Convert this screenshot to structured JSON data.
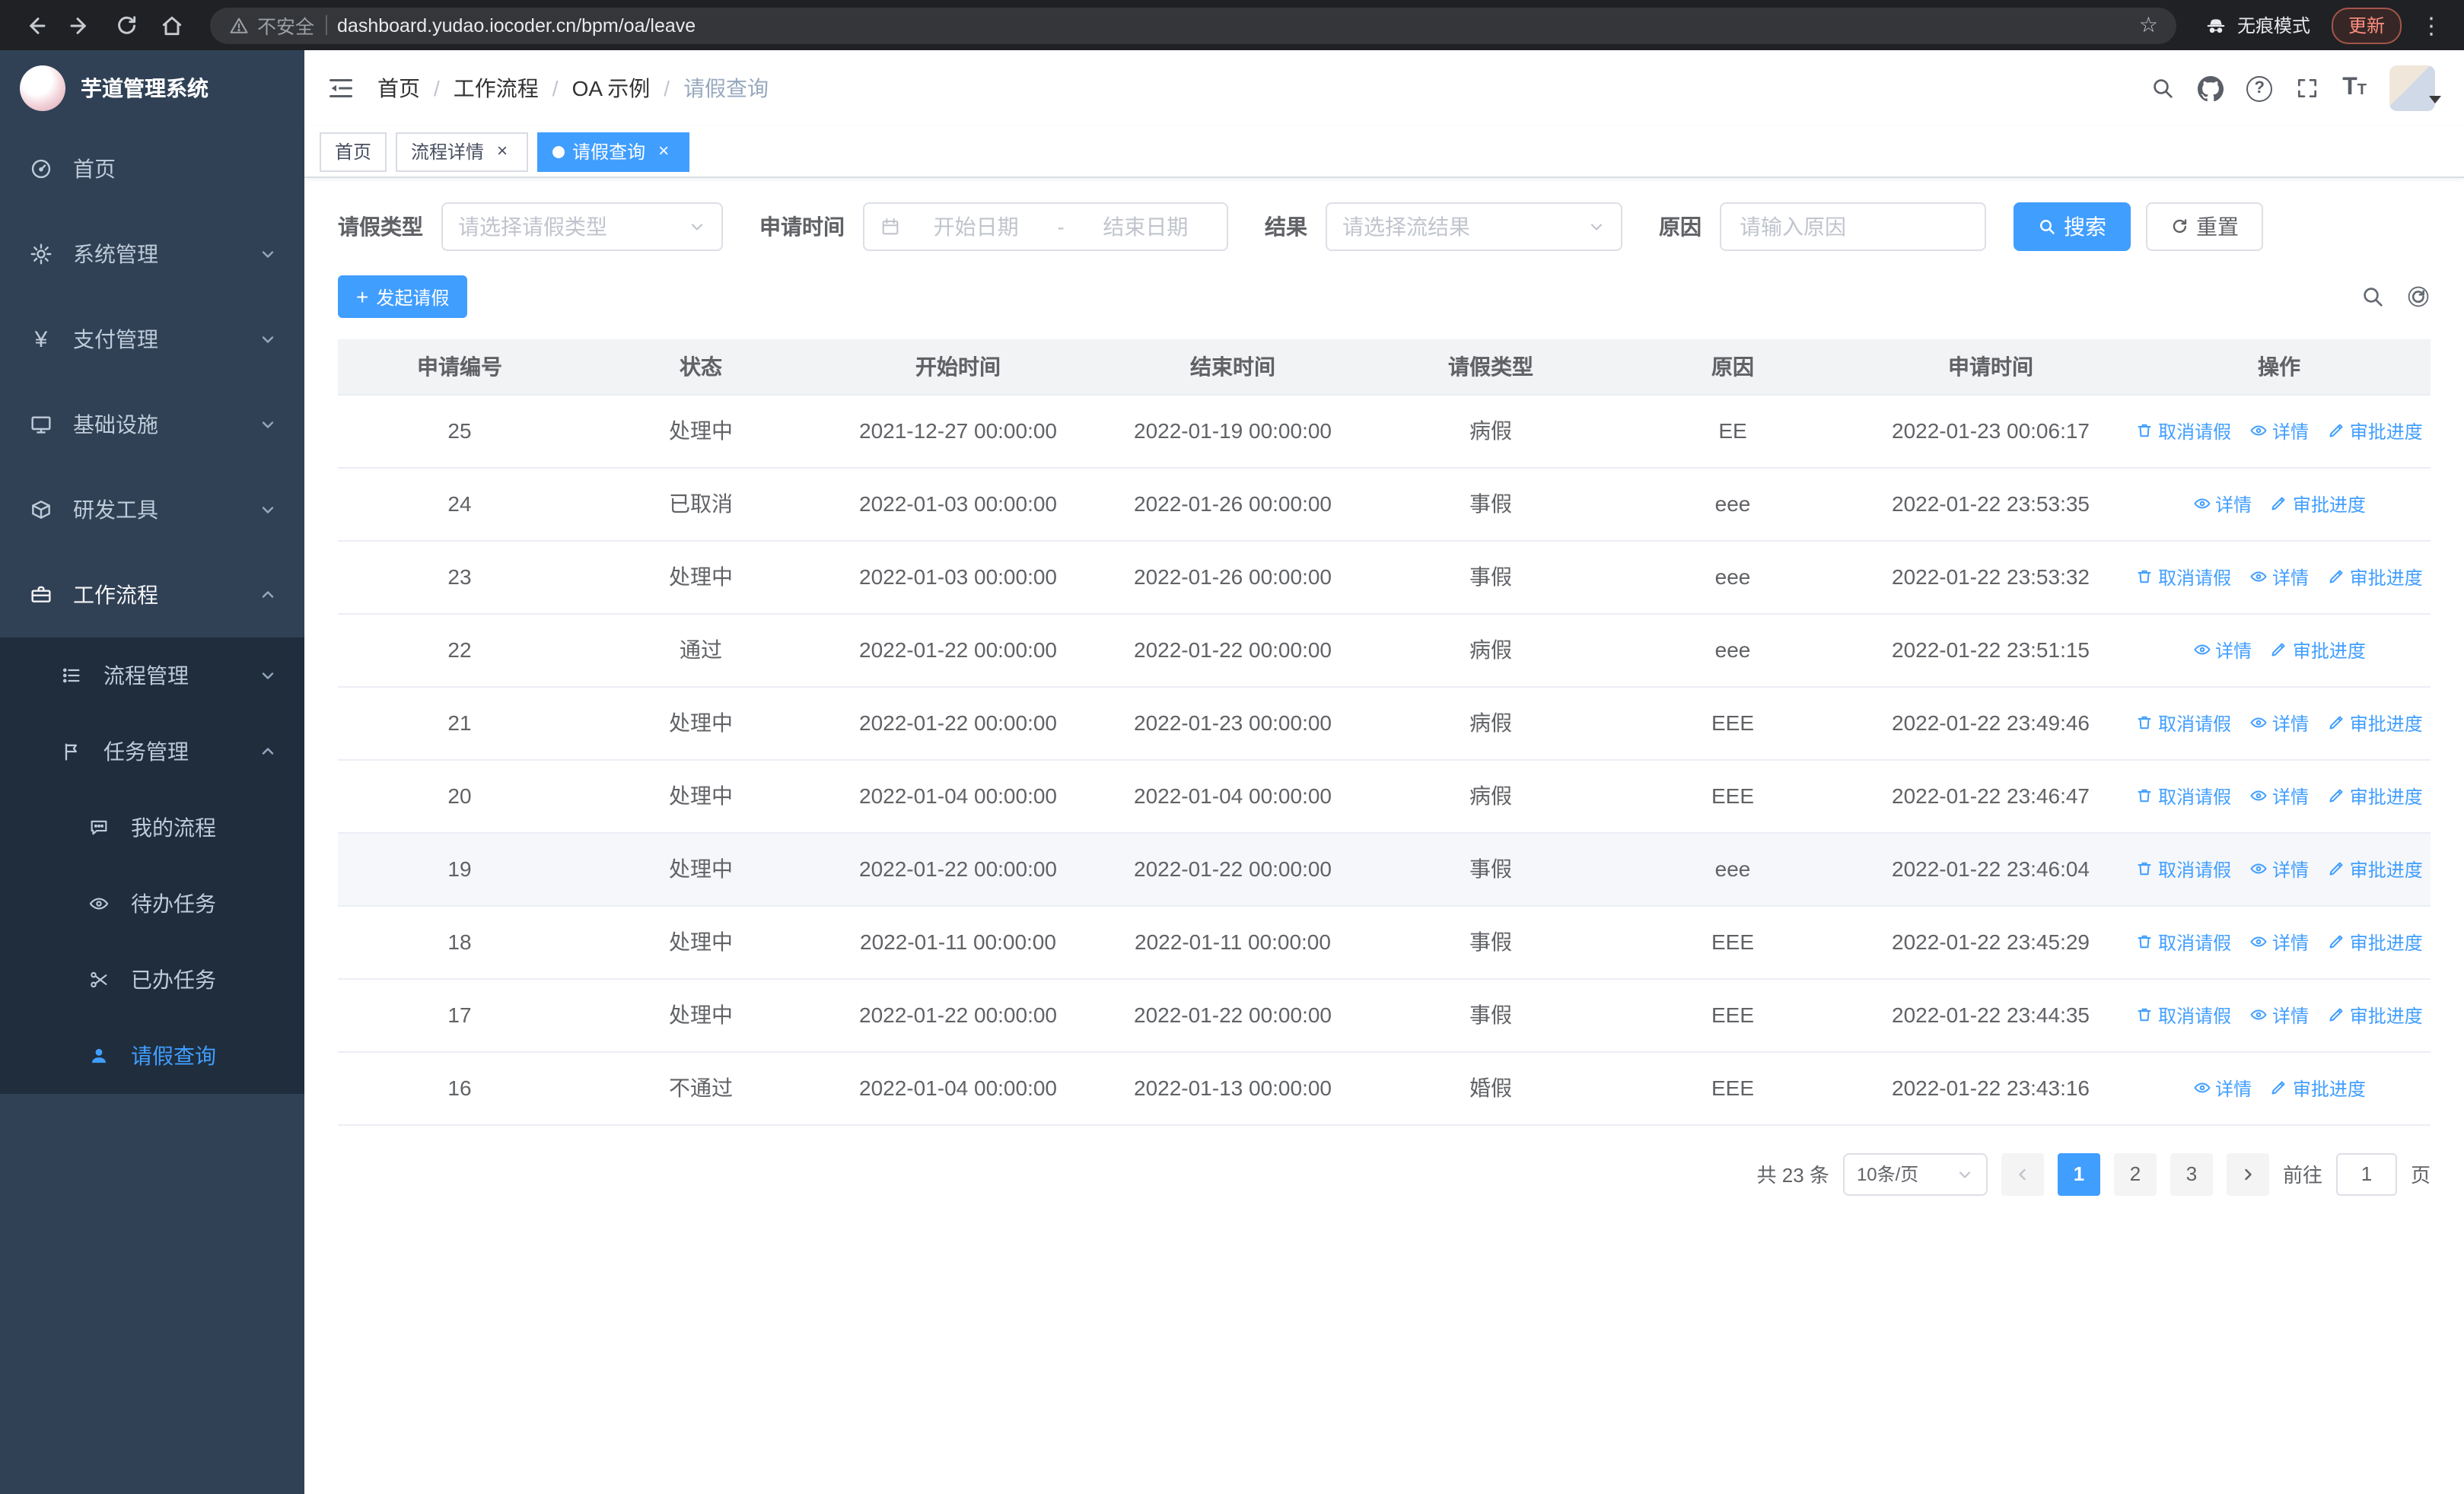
{
  "browser": {
    "security_label": "不安全",
    "url": "dashboard.yudao.iocoder.cn/bpm/oa/leave",
    "incognito_label": "无痕模式",
    "update_label": "更新"
  },
  "icons": {
    "yen": "¥",
    "close": "×",
    "question": "?",
    "dots": "⋮",
    "star": "☆",
    "plus": "+",
    "font_large": "T",
    "font_small": "T"
  },
  "sidebar": {
    "title": "芋道管理系统",
    "items": [
      {
        "label": "首页"
      },
      {
        "label": "系统管理"
      },
      {
        "label": "支付管理"
      },
      {
        "label": "基础设施"
      },
      {
        "label": "研发工具"
      },
      {
        "label": "工作流程"
      }
    ],
    "submenu": [
      {
        "label": "流程管理"
      },
      {
        "label": "任务管理"
      }
    ],
    "leaf_items": [
      {
        "label": "我的流程"
      },
      {
        "label": "待办任务"
      },
      {
        "label": "已办任务"
      },
      {
        "label": "请假查询"
      }
    ]
  },
  "header": {
    "breadcrumb": [
      "首页",
      "工作流程",
      "OA 示例",
      "请假查询"
    ]
  },
  "tabs": [
    {
      "label": "首页"
    },
    {
      "label": "流程详情"
    },
    {
      "label": "请假查询"
    }
  ],
  "filter": {
    "leave_type": {
      "label": "请假类型",
      "placeholder": "请选择请假类型"
    },
    "apply_time": {
      "label": "申请时间",
      "start_placeholder": "开始日期",
      "separator": "-",
      "end_placeholder": "结束日期"
    },
    "result": {
      "label": "结果",
      "placeholder": "请选择流结果"
    },
    "reason": {
      "label": "原因",
      "placeholder": "请输入原因"
    },
    "search_label": "搜索",
    "reset_label": "重置"
  },
  "toolbar": {
    "create_label": "发起请假"
  },
  "table": {
    "columns": [
      "申请编号",
      "状态",
      "开始时间",
      "结束时间",
      "请假类型",
      "原因",
      "申请时间",
      "操作"
    ],
    "actions": {
      "cancel": "取消请假",
      "detail": "详情",
      "progress": "审批进度"
    },
    "rows": [
      {
        "id": "25",
        "status": "处理中",
        "start": "2021-12-27 00:00:00",
        "end": "2022-01-19 00:00:00",
        "type": "病假",
        "reason": "EE",
        "applied": "2022-01-23 00:06:17",
        "cancellable": true,
        "hover": false
      },
      {
        "id": "24",
        "status": "已取消",
        "start": "2022-01-03 00:00:00",
        "end": "2022-01-26 00:00:00",
        "type": "事假",
        "reason": "eee",
        "applied": "2022-01-22 23:53:35",
        "cancellable": false,
        "hover": false
      },
      {
        "id": "23",
        "status": "处理中",
        "start": "2022-01-03 00:00:00",
        "end": "2022-01-26 00:00:00",
        "type": "事假",
        "reason": "eee",
        "applied": "2022-01-22 23:53:32",
        "cancellable": true,
        "hover": false
      },
      {
        "id": "22",
        "status": "通过",
        "start": "2022-01-22 00:00:00",
        "end": "2022-01-22 00:00:00",
        "type": "病假",
        "reason": "eee",
        "applied": "2022-01-22 23:51:15",
        "cancellable": false,
        "hover": false
      },
      {
        "id": "21",
        "status": "处理中",
        "start": "2022-01-22 00:00:00",
        "end": "2022-01-23 00:00:00",
        "type": "病假",
        "reason": "EEE",
        "applied": "2022-01-22 23:49:46",
        "cancellable": true,
        "hover": false
      },
      {
        "id": "20",
        "status": "处理中",
        "start": "2022-01-04 00:00:00",
        "end": "2022-01-04 00:00:00",
        "type": "病假",
        "reason": "EEE",
        "applied": "2022-01-22 23:46:47",
        "cancellable": true,
        "hover": false
      },
      {
        "id": "19",
        "status": "处理中",
        "start": "2022-01-22 00:00:00",
        "end": "2022-01-22 00:00:00",
        "type": "事假",
        "reason": "eee",
        "applied": "2022-01-22 23:46:04",
        "cancellable": true,
        "hover": true
      },
      {
        "id": "18",
        "status": "处理中",
        "start": "2022-01-11 00:00:00",
        "end": "2022-01-11 00:00:00",
        "type": "事假",
        "reason": "EEE",
        "applied": "2022-01-22 23:45:29",
        "cancellable": true,
        "hover": false
      },
      {
        "id": "17",
        "status": "处理中",
        "start": "2022-01-22 00:00:00",
        "end": "2022-01-22 00:00:00",
        "type": "事假",
        "reason": "EEE",
        "applied": "2022-01-22 23:44:35",
        "cancellable": true,
        "hover": false
      },
      {
        "id": "16",
        "status": "不通过",
        "start": "2022-01-04 00:00:00",
        "end": "2022-01-13 00:00:00",
        "type": "婚假",
        "reason": "EEE",
        "applied": "2022-01-22 23:43:16",
        "cancellable": false,
        "hover": false
      }
    ]
  },
  "pagination": {
    "total": "共 23 条",
    "page_size": "10条/页",
    "pages": [
      "1",
      "2",
      "3"
    ],
    "goto_label": "前往",
    "goto_value": "1",
    "page_unit": "页"
  }
}
